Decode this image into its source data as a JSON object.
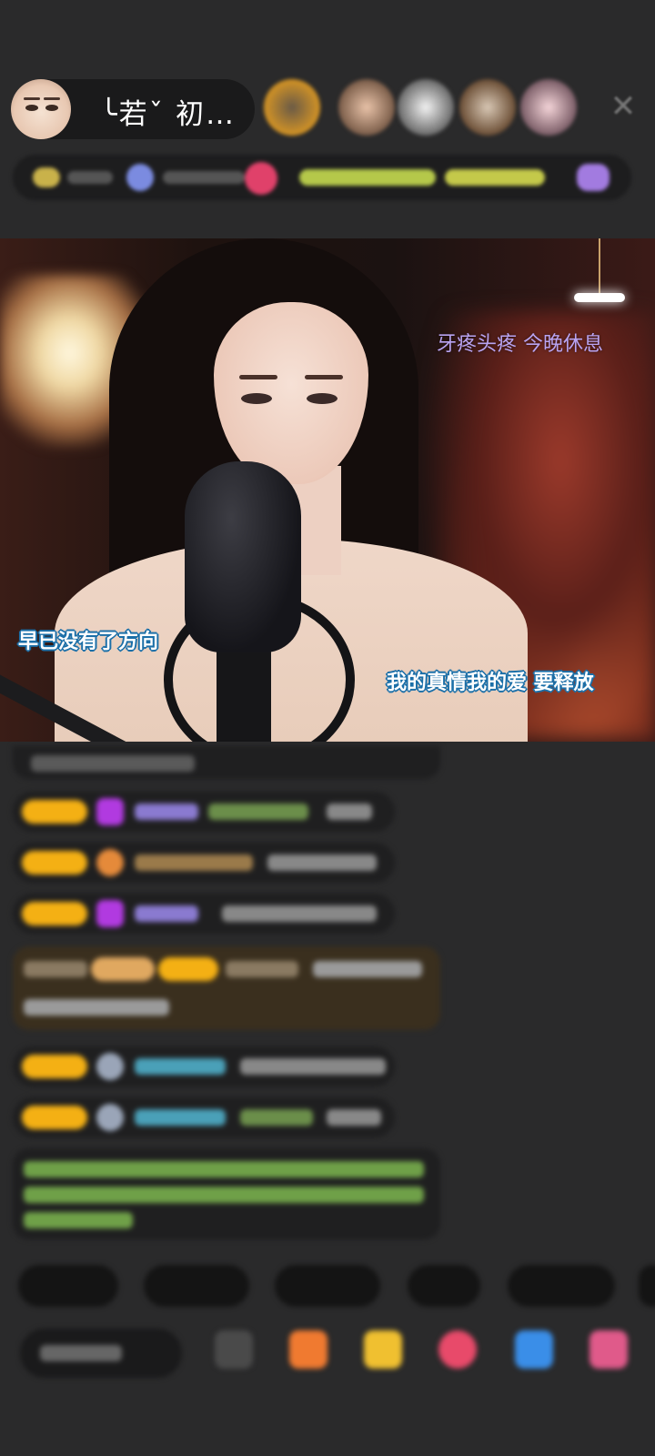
{
  "header": {
    "host_name": "╰若ˇ 初…",
    "avatar_icon": "avatar",
    "viewer_avatars": 5,
    "close_icon": "close-icon"
  },
  "video": {
    "notice": "牙疼头疼 今晚休息",
    "lyric_left": "早已没有了方向",
    "lyric_right": "我的真情我的爱 要释放"
  },
  "colors": {
    "background": "#2a2a2b",
    "badge": "#f4b014",
    "notice": "#b9a4f2",
    "lyric_outline": "#1b6fa8"
  }
}
